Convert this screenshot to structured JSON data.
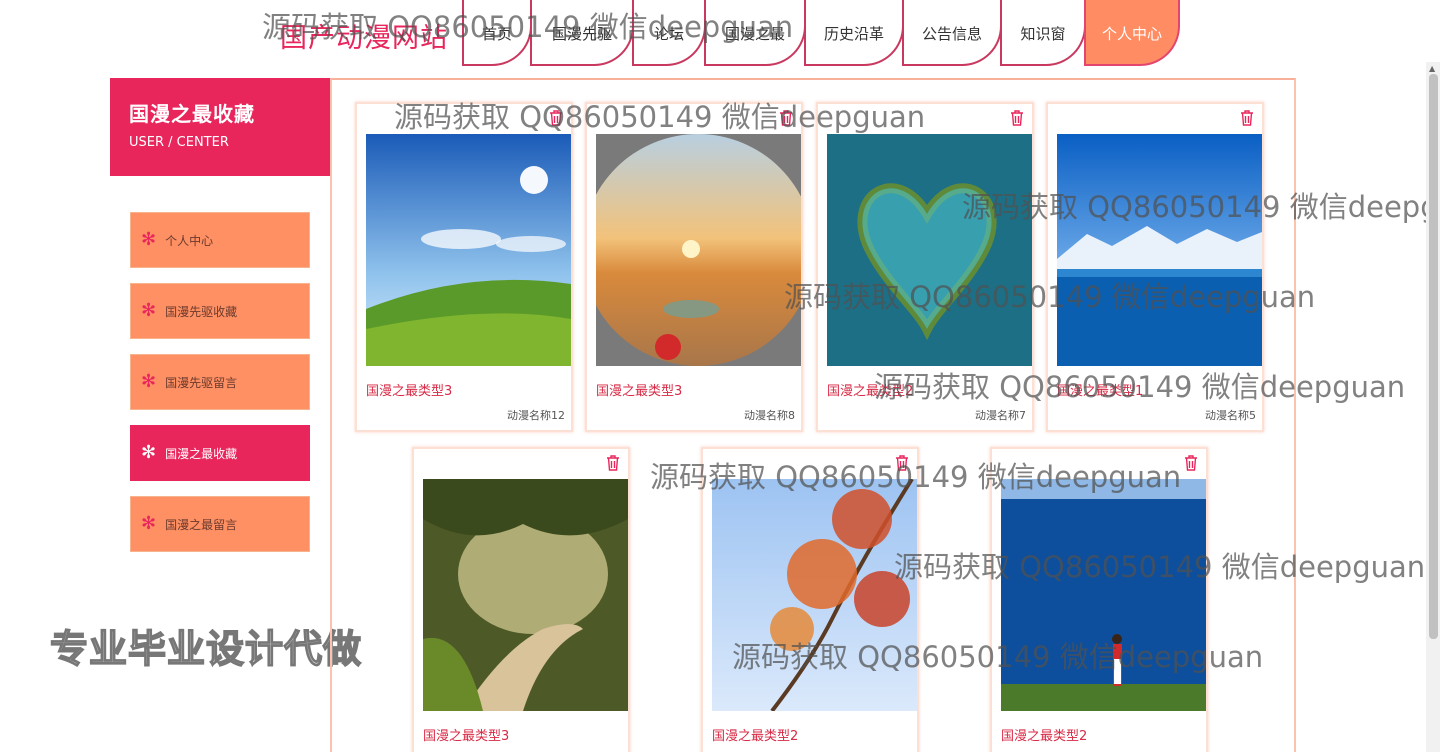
{
  "header": {
    "site_title": "国产动漫网站",
    "nav": [
      {
        "label": "首页"
      },
      {
        "label": "国漫先驱"
      },
      {
        "label": "论坛"
      },
      {
        "label": "国漫之最"
      },
      {
        "label": "历史沿革"
      },
      {
        "label": "公告信息"
      },
      {
        "label": "知识窗"
      },
      {
        "label": "个人中心",
        "active": true
      }
    ]
  },
  "sidebar": {
    "title": "国漫之最收藏",
    "subtitle": "USER / CENTER",
    "items": [
      {
        "label": "个人中心"
      },
      {
        "label": "国漫先驱收藏"
      },
      {
        "label": "国漫先驱留言"
      },
      {
        "label": "国漫之最收藏",
        "active": true
      },
      {
        "label": "国漫之最留言"
      }
    ]
  },
  "cards": [
    {
      "type": "国漫之最类型3",
      "anime": "动漫名称12",
      "image": "sky-meadow"
    },
    {
      "type": "国漫之最类型3",
      "anime": "动漫名称8",
      "image": "desert-sunset"
    },
    {
      "type": "国漫之最类型2",
      "anime": "动漫名称7",
      "image": "heart-island"
    },
    {
      "type": "国漫之最类型1",
      "anime": "动漫名称5",
      "image": "snow-lake"
    },
    {
      "type": "国漫之最类型3",
      "anime": "",
      "image": "forest-path"
    },
    {
      "type": "国漫之最类型2",
      "anime": "",
      "image": "autumn-leaves"
    },
    {
      "type": "国漫之最类型2",
      "anime": "",
      "image": "blue-lake-girl"
    }
  ],
  "watermark": {
    "text": "源码获取 QQ86050149 微信deepguan",
    "text_clipped": "源码获取 QQ86050149 微信deepg",
    "promo": "专业毕业设计代做"
  },
  "colors": {
    "accent": "#e8265c",
    "menu": "#ff9064",
    "nav_active": "#ff8c63"
  }
}
